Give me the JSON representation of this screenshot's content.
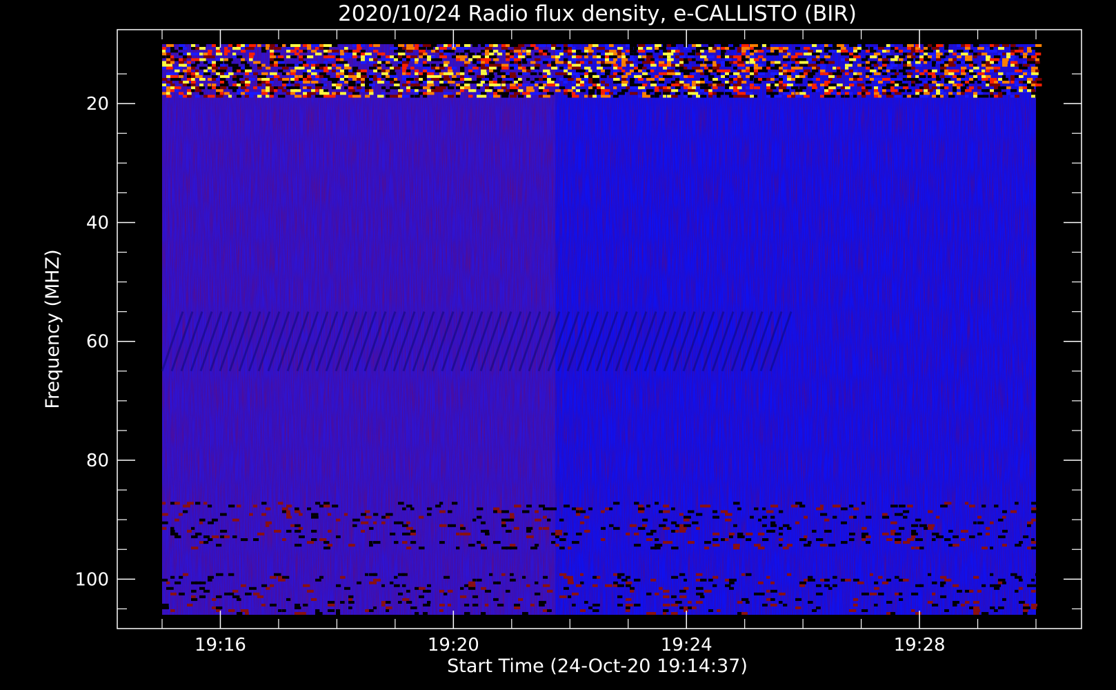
{
  "chart_data": {
    "type": "heatmap",
    "title": "2020/10/24  Radio flux density, e-CALLISTO (BIR)",
    "xlabel": "Start Time (24-Oct-20 19:14:37)",
    "ylabel": "Frequency (MHZ)",
    "x_range": [
      "19:15:00",
      "19:30:00"
    ],
    "y_range": [
      10,
      106
    ],
    "y_inverted": true,
    "x_ticks": [
      {
        "label": "19:16",
        "minutes": 16
      },
      {
        "label": "19:20",
        "minutes": 20
      },
      {
        "label": "19:24",
        "minutes": 24
      },
      {
        "label": "19:28",
        "minutes": 28
      }
    ],
    "y_ticks": [
      20,
      40,
      60,
      80,
      100
    ],
    "colormap": {
      "low": "#000000",
      "mid": "#1a1aff",
      "high": "#ff2000",
      "peak": "#ffff40"
    },
    "background_color": "#1010ee",
    "features": [
      {
        "kind": "noisy interference band",
        "freq_mhz": [
          10,
          19
        ]
      },
      {
        "kind": "drifting stripes",
        "freq_mhz": [
          55,
          65
        ]
      },
      {
        "kind": "noisy interference band",
        "freq_mhz": [
          87,
          95
        ]
      },
      {
        "kind": "noisy interference band",
        "freq_mhz": [
          99,
          106
        ]
      }
    ]
  }
}
